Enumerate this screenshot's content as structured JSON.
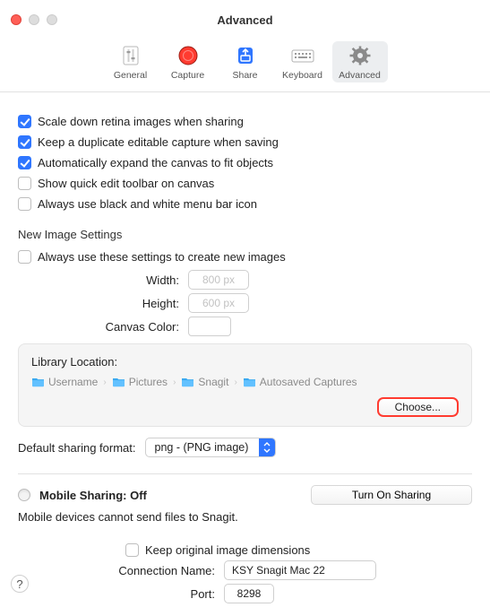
{
  "window": {
    "title": "Advanced"
  },
  "toolbar": {
    "general": "General",
    "capture": "Capture",
    "share": "Share",
    "keyboard": "Keyboard",
    "advanced": "Advanced"
  },
  "options": {
    "scale_down": "Scale down retina images when sharing",
    "keep_dup": "Keep a duplicate editable capture when saving",
    "auto_expand": "Automatically expand the canvas to fit objects",
    "quick_edit": "Show quick edit toolbar on canvas",
    "bw_menubar": "Always use black and white menu bar icon"
  },
  "new_image": {
    "section": "New Image Settings",
    "always_use": "Always use these settings to create new images",
    "width_label": "Width:",
    "width_ph": "800 px",
    "height_label": "Height:",
    "height_ph": "600 px",
    "canvas_label": "Canvas Color:"
  },
  "library": {
    "title": "Library Location:",
    "path": [
      "Username",
      "Pictures",
      "Snagit",
      "Autosaved Captures"
    ],
    "choose": "Choose..."
  },
  "sharing_format": {
    "label": "Default sharing format:",
    "value": "png - (PNG image)"
  },
  "mobile": {
    "title": "Mobile Sharing: Off",
    "desc": "Mobile devices cannot send files to Snagit.",
    "turn_on": "Turn On Sharing",
    "keep_dims": "Keep original image dimensions",
    "conn_label": "Connection Name:",
    "conn_value": "KSY Snagit Mac 22",
    "port_label": "Port:",
    "port_value": "8298"
  },
  "help": "?"
}
